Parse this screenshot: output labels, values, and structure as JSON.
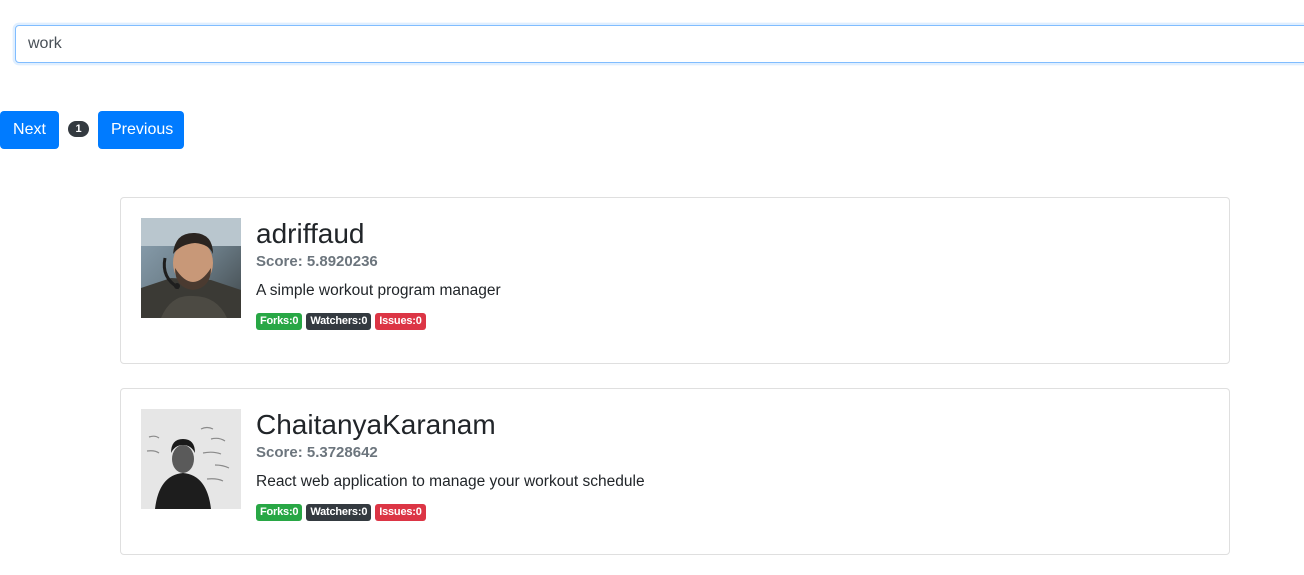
{
  "search": {
    "value": "work"
  },
  "pagination": {
    "next_label": "Next",
    "page": "1",
    "prev_label": "Previous"
  },
  "colors": {
    "primary": "#007bff",
    "success": "#28a745",
    "dark": "#343a40",
    "danger": "#dc3545",
    "muted": "#6c757d"
  },
  "results": [
    {
      "owner": "adriffaud",
      "score": "Score: 5.8920236",
      "description": "A simple workout program manager",
      "forks": "Forks:0",
      "watchers": "Watchers:0",
      "issues": "Issues:0",
      "avatar_icon": "user-photo-icon"
    },
    {
      "owner": "ChaitanyaKaranam",
      "score": "Score: 5.3728642",
      "description": "React web application to manage your workout schedule",
      "forks": "Forks:0",
      "watchers": "Watchers:0",
      "issues": "Issues:0",
      "avatar_icon": "user-photo-icon"
    }
  ]
}
